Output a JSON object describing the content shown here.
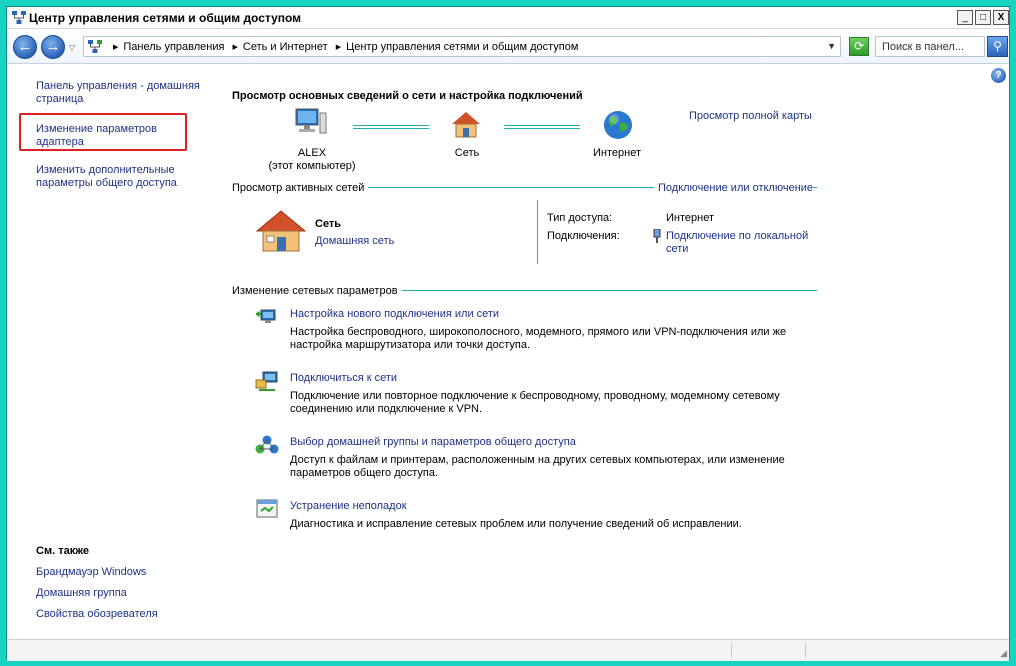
{
  "window": {
    "title": "Центр управления сетями и общим доступом",
    "controls": {
      "minimize": "_",
      "maximize": "□",
      "close": "X"
    }
  },
  "toolbar": {
    "back_glyph": "←",
    "forward_glyph": "→",
    "breadcrumbs": [
      "Панель управления",
      "Сеть и Интернет",
      "Центр управления сетями и общим доступом"
    ],
    "search_placeholder": "Поиск в панел...",
    "refresh_icon": "refresh-icon",
    "search_icon": "search-icon"
  },
  "sidebar": {
    "links": [
      "Панель управления - домашняя страница",
      "Изменение параметров адаптера",
      "Изменить дополнительные параметры общего доступа"
    ],
    "see_also_title": "См. также",
    "see_also_links": [
      "Брандмауэр Windows",
      "Домашняя группа",
      "Свойства обозревателя"
    ]
  },
  "main": {
    "heading": "Просмотр основных сведений о сети и настройка подключений",
    "full_map_link": "Просмотр полной карты",
    "map": {
      "computer_name": "ALEX",
      "computer_sub": "(этот компьютер)",
      "network": "Сеть",
      "internet": "Интернет"
    },
    "active_networks_title": "Просмотр активных сетей",
    "connect_disconnect_link": "Подключение или отключение",
    "active_network": {
      "name": "Сеть",
      "type": "Домашняя сеть",
      "access_type_label": "Тип доступа:",
      "access_type_value": "Интернет",
      "connections_label": "Подключения:",
      "connection_link": "Подключение по локальной сети"
    },
    "change_settings_title": "Изменение сетевых параметров",
    "tasks": [
      {
        "title": "Настройка нового подключения или сети",
        "desc": "Настройка беспроводного, широкополосного, модемного, прямого или VPN-подключения или же настройка маршрутизатора или точки доступа."
      },
      {
        "title": "Подключиться к сети",
        "desc": "Подключение или повторное подключение к беспроводному, проводному, модемному сетевому соединению или подключение к VPN."
      },
      {
        "title": "Выбор домашней группы и параметров общего доступа",
        "desc": "Доступ к файлам и принтерам, расположенным на других сетевых компьютерах, или изменение параметров общего доступа."
      },
      {
        "title": "Устранение неполадок",
        "desc": "Диагностика и исправление сетевых проблем или получение сведений об исправлении."
      }
    ]
  },
  "colors": {
    "link": "#1e3287",
    "frame": "#18d3c0",
    "highlight": "#e02020"
  }
}
